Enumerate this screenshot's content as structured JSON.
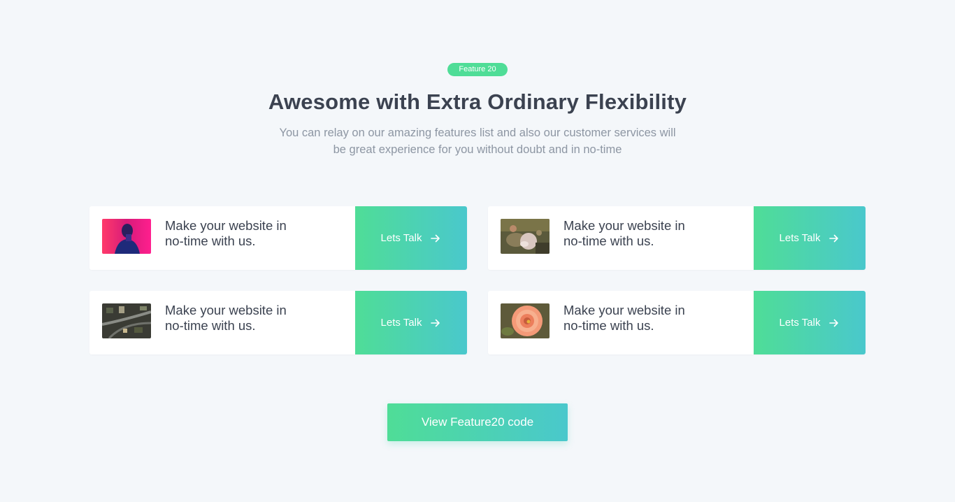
{
  "header": {
    "badge": "Feature 20",
    "title": "Awesome with Extra Ordinary Flexibility",
    "subtitle_line1": "You can relay on our amazing features list and also our customer services will",
    "subtitle_line2": "be great experience for you without doubt and in no-time"
  },
  "colors": {
    "accent_start": "#4fdd97",
    "accent_end": "#4ac8cc",
    "heading": "#3b4250",
    "muted": "#8d96a3",
    "background": "#f4f7fa"
  },
  "cards": [
    {
      "line1": "Make your website in",
      "line2": "no-time with us.",
      "cta": "Lets Talk",
      "cta_icon": "arrow-right-icon",
      "image": "person-neon-photo"
    },
    {
      "line1": "Make your website in",
      "line2": "no-time with us.",
      "cta": "Lets Talk",
      "cta_icon": "arrow-right-icon",
      "image": "hands-flowers-photo"
    },
    {
      "line1": "Make your website in",
      "line2": "no-time with us.",
      "cta": "Lets Talk",
      "cta_icon": "arrow-right-icon",
      "image": "aerial-city-photo"
    },
    {
      "line1": "Make your website in",
      "line2": "no-time with us.",
      "cta": "Lets Talk",
      "cta_icon": "arrow-right-icon",
      "image": "orange-rose-photo"
    }
  ],
  "footer": {
    "button": "View Feature20 code"
  }
}
